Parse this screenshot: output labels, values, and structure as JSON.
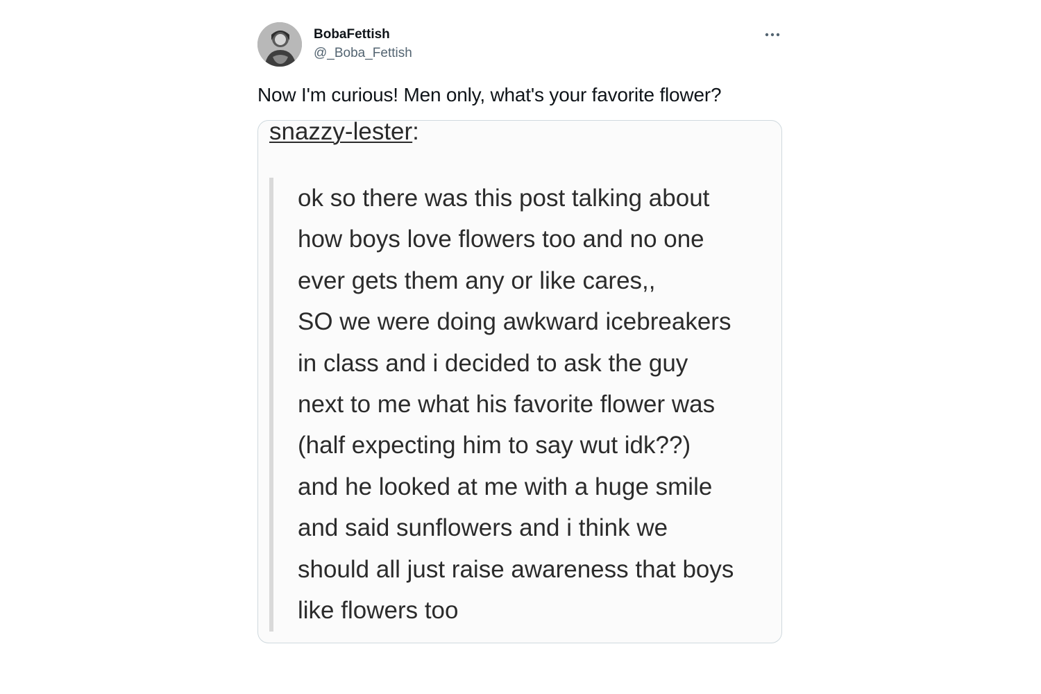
{
  "tweet": {
    "display_name": "BobaFettish",
    "handle": "@_Boba_Fettish",
    "more_label": "···",
    "text": "Now I'm curious! Men only, what's your favorite flower?",
    "avatar_icon": "profile-avatar-icon"
  },
  "media": {
    "post_author": "snazzy-lester",
    "post_author_suffix": ":",
    "lines": [
      "ok so there was this post talking about",
      "how boys love flowers too and no one",
      "ever gets them any or like cares,,",
      "SO we were doing awkward icebreakers",
      "in class and i decided to ask the guy",
      "next to me what his favorite flower was",
      "(half expecting him to say wut idk??)",
      "and he looked at me with a huge smile",
      "and said sunflowers and i think we",
      "should all just raise awareness that boys",
      "like flowers too"
    ]
  },
  "colors": {
    "text_primary": "#0f1419",
    "text_secondary": "#536471",
    "border": "#cfd9de"
  }
}
